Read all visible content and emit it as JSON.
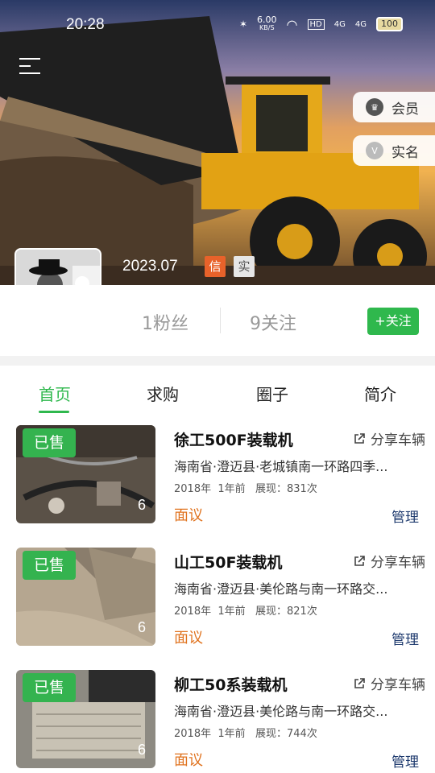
{
  "status_bar": {
    "time": "20:28",
    "speed": "6.00",
    "speed_unit": "KB/S",
    "hd": "HD",
    "net1": "4G",
    "net2": "4G",
    "battery": "100"
  },
  "profile": {
    "badges": [
      {
        "label": "会员",
        "icon": "member-badge-icon"
      },
      {
        "label": "实名",
        "icon": "verified-v-icon"
      }
    ],
    "join_date": "2023.07",
    "tag_credit": "信",
    "tag_real": "实",
    "fans": "1粉丝",
    "following": "9关注",
    "follow_button": "+关注"
  },
  "tabs": [
    "首页",
    "求购",
    "圈子",
    "简介"
  ],
  "active_tab": 0,
  "listings": [
    {
      "status": "已售",
      "photos": "6",
      "title": "徐工500F装载机",
      "share": "分享车辆",
      "address": "海南省·澄迈县·老城镇南一环路四季...",
      "meta": "2018年  1年前   展现：831次",
      "price": "面议",
      "manage": "管理"
    },
    {
      "status": "已售",
      "photos": "6",
      "title": "山工50F装载机",
      "share": "分享车辆",
      "address": "海南省·澄迈县·美伦路与南一环路交...",
      "meta": "2018年  1年前   展现：821次",
      "price": "面议",
      "manage": "管理"
    },
    {
      "status": "已售",
      "photos": "6",
      "title": "柳工50系装载机",
      "share": "分享车辆",
      "address": "海南省·澄迈县·美伦路与南一环路交...",
      "meta": "2018年  1年前   展现：744次",
      "price": "面议",
      "manage": "管理"
    }
  ],
  "colors": {
    "accent_green": "#2fb84d",
    "price_orange": "#e0731f",
    "manage_blue": "#1e3a6e",
    "credit_tag": "#e8622a"
  }
}
